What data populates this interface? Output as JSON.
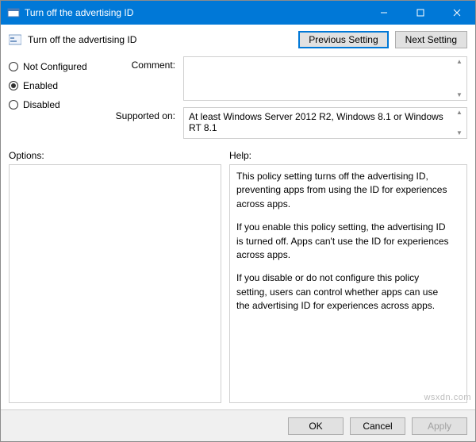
{
  "window": {
    "title": "Turn off the advertising ID"
  },
  "header": {
    "policy_name": "Turn off the advertising ID"
  },
  "nav": {
    "previous": "Previous Setting",
    "next": "Next Setting"
  },
  "radios": {
    "not_configured": "Not Configured",
    "enabled": "Enabled",
    "disabled": "Disabled",
    "selected": "enabled"
  },
  "meta": {
    "comment_label": "Comment:",
    "comment_value": "",
    "supported_label": "Supported on:",
    "supported_value": "At least Windows Server 2012 R2, Windows 8.1 or Windows RT 8.1"
  },
  "panes": {
    "options_label": "Options:",
    "help_label": "Help:",
    "help_paragraphs": [
      "This policy setting turns off the advertising ID, preventing apps from using the ID for experiences across apps.",
      "If you enable this policy setting, the advertising ID is turned off. Apps can't use the ID for experiences across apps.",
      "If you disable or do not configure this policy setting, users can control whether apps can use the advertising ID for experiences across apps."
    ]
  },
  "footer": {
    "ok": "OK",
    "cancel": "Cancel",
    "apply": "Apply"
  },
  "watermark": "wsxdn.com"
}
